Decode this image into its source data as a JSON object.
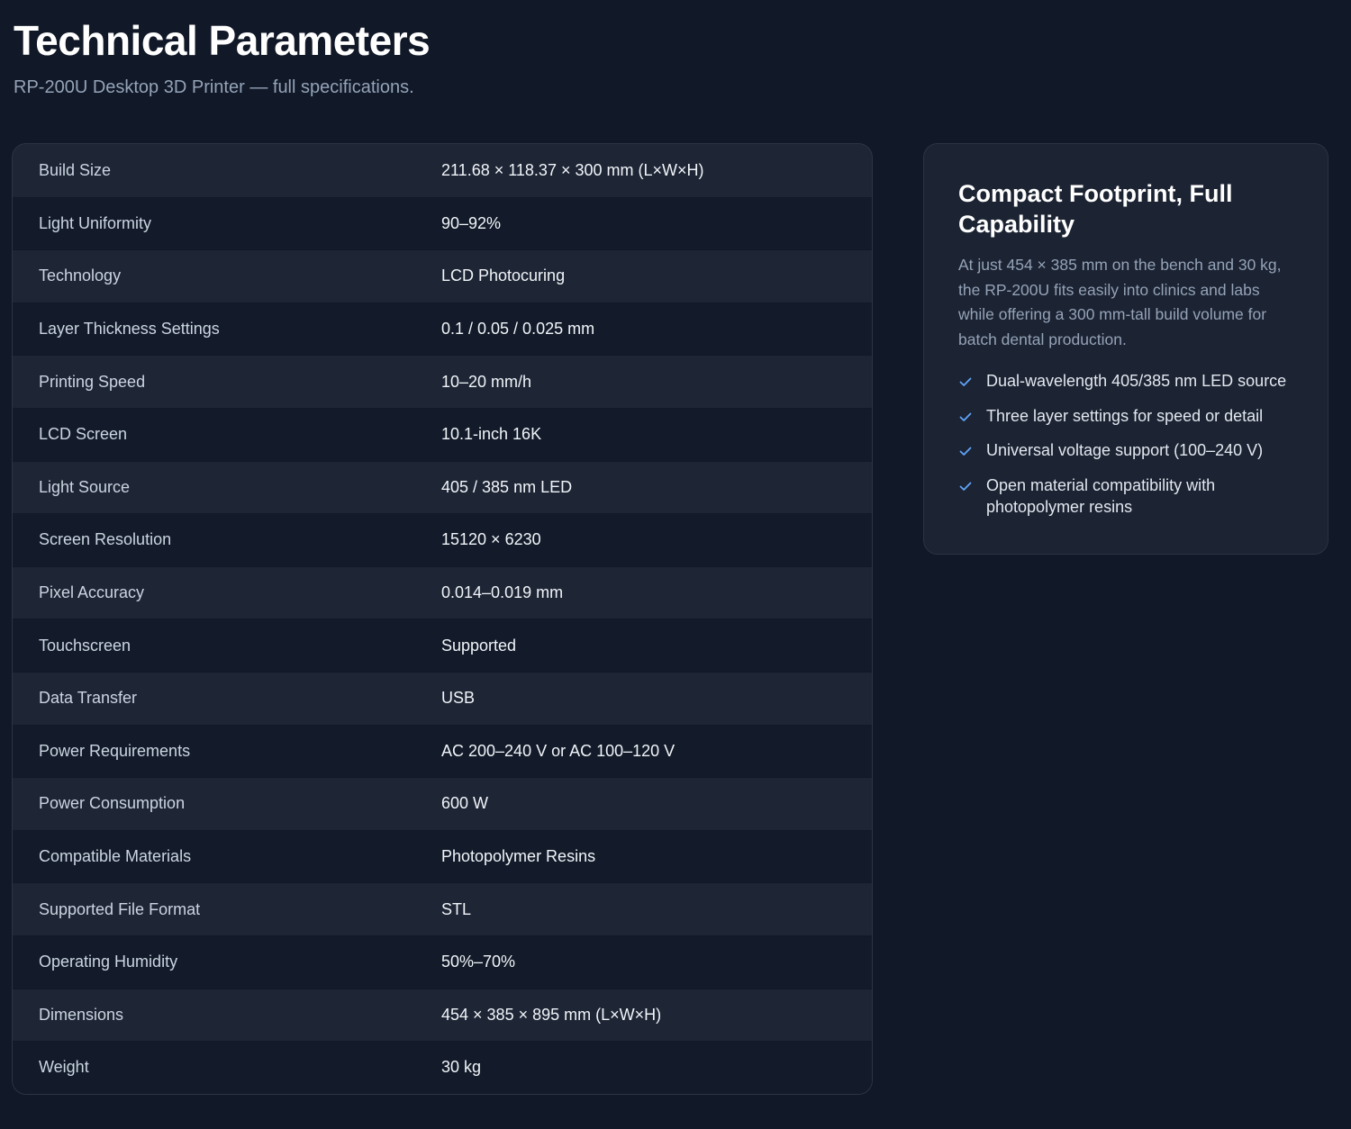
{
  "header": {
    "title": "Technical Parameters",
    "subtitle": "RP-200U Desktop 3D Printer — full specifications."
  },
  "specs": [
    {
      "label": "Build Size",
      "value": "211.68 × 118.37 × 300 mm (L×W×H)"
    },
    {
      "label": "Light Uniformity",
      "value": "90–92%"
    },
    {
      "label": "Technology",
      "value": "LCD Photocuring"
    },
    {
      "label": "Layer Thickness Settings",
      "value": "0.1 / 0.05 / 0.025 mm"
    },
    {
      "label": "Printing Speed",
      "value": "10–20 mm/h"
    },
    {
      "label": "LCD Screen",
      "value": "10.1-inch 16K"
    },
    {
      "label": "Light Source",
      "value": "405 / 385 nm LED"
    },
    {
      "label": "Screen Resolution",
      "value": "15120 × 6230"
    },
    {
      "label": "Pixel Accuracy",
      "value": "0.014–0.019 mm"
    },
    {
      "label": "Touchscreen",
      "value": "Supported"
    },
    {
      "label": "Data Transfer",
      "value": "USB"
    },
    {
      "label": "Power Requirements",
      "value": "AC 200–240 V or AC 100–120 V"
    },
    {
      "label": "Power Consumption",
      "value": "600 W"
    },
    {
      "label": "Compatible Materials",
      "value": "Photopolymer Resins"
    },
    {
      "label": "Supported File Format",
      "value": "STL"
    },
    {
      "label": "Operating Humidity",
      "value": "50%–70%"
    },
    {
      "label": "Dimensions",
      "value": "454 × 385 × 895 mm (L×W×H)"
    },
    {
      "label": "Weight",
      "value": "30 kg"
    }
  ],
  "card": {
    "title": "Compact Footprint, Full Capability",
    "text": "At just 454 × 385 mm on the bench and 30 kg, the RP-200U fits easily into clinics and labs while offering a 300 mm-tall build volume for batch dental production.",
    "features": [
      "Dual-wavelength 405/385 nm LED source",
      "Three layer settings for speed or detail",
      "Universal voltage support (100–240 V)",
      "Open material compatibility with photopolymer resins"
    ],
    "check_icon": "check-icon"
  },
  "colors": {
    "background": "#111827",
    "accent": "#60a5fa",
    "row_alt": "#131b2a",
    "row_base": "#1e2535"
  }
}
